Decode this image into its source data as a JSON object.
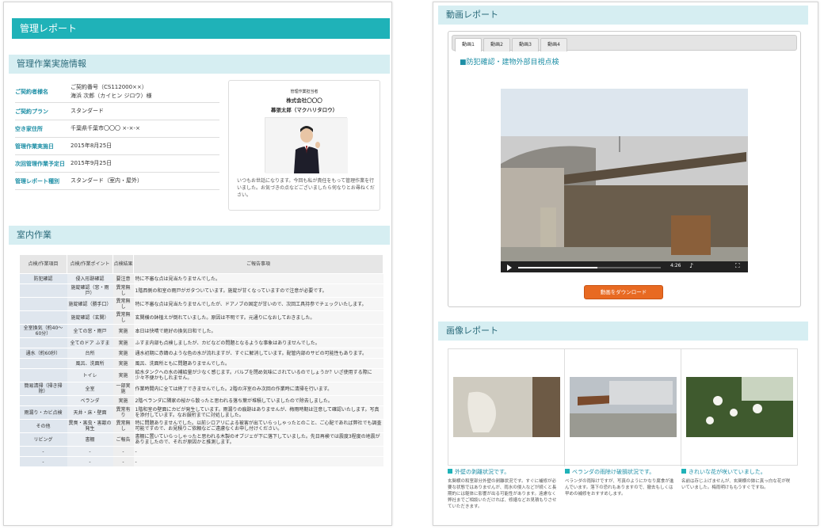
{
  "report": {
    "title": "管理レポート",
    "info_heading": "管理作業実施情報",
    "info_rows": [
      {
        "key": "ご契約者様名",
        "value": "ご契約番号（CS112000××）",
        "value2": "海浜 次郎（カイヒン ジロウ）様"
      },
      {
        "key": "ご契約プラン",
        "value": "スタンダード",
        "value2": ""
      },
      {
        "key": "空き家住所",
        "value": "千葉県千葉市〇〇〇 ×-×-×",
        "value2": ""
      },
      {
        "key": "管理作業実施日",
        "value": "2015年8月25日",
        "value2": ""
      },
      {
        "key": "次回管理作業予定日",
        "value": "2015年9月25日",
        "value2": ""
      },
      {
        "key": "管理レポート種別",
        "value": "スタンダード（室内・屋外）",
        "value2": ""
      }
    ],
    "staff": {
      "role": "管理作業担当者",
      "company": "株式会社〇〇〇",
      "name": "幕張太郎（マクハリタロウ）",
      "message": "いつもお世話になります。今回も私が責任をもって管理作業を行いました。お気づきの点などございましたら何なりとお尋ねください。"
    },
    "indoor_heading": "室内作業",
    "indoor_headers": [
      "点検/作業項目",
      "点検/作業ポイント",
      "点検結果",
      "ご報告事項"
    ],
    "indoor_rows": [
      {
        "cat": "防犯確認",
        "point": "侵入形跡確認",
        "res": "要注意",
        "note": "特に不審な点は見当たりませんでした。",
        "sep": true
      },
      {
        "cat": "",
        "point": "施錠確認（窓・雨戸）",
        "res": "異常無し",
        "note": "1階西側の和室の雨戸がガタついています。施錠が甘くなっていますので注意が必要です。",
        "sep": false
      },
      {
        "cat": "",
        "point": "施錠確認（勝手口）",
        "res": "異常無し",
        "note": "特に不審な点は見当たりませんでしたが、ドアノブの固定が甘いので、次回工具持参でチェックいたします。",
        "sep": false
      },
      {
        "cat": "",
        "point": "施錠確認（玄関）",
        "res": "異常無し",
        "note": "玄関横の鉢植えが倒れていました。原因は不明です。元通りになおしておきました。",
        "sep": false
      },
      {
        "cat": "全室換気（約40〜60分）",
        "point": "全ての窓・雨戸",
        "res": "実施",
        "note": "本日は快晴で絶好の換気日和でした。",
        "sep": true
      },
      {
        "cat": "",
        "point": "全てのドア ふすま",
        "res": "実施",
        "note": "ふすま内部も点検しましたが、カビなどの問題となるような事象はありませんでした。",
        "sep": false
      },
      {
        "cat": "通水（約60秒）",
        "point": "台所",
        "res": "実施",
        "note": "通水初期に赤錆のような色の水が流れますが、すぐに解消しています。配管内部のサビの可能性もあります。",
        "sep": true
      },
      {
        "cat": "",
        "point": "風呂、洗面所",
        "res": "実施",
        "note": "風呂、洗面所ともに問題ありませんでした。",
        "sep": false
      },
      {
        "cat": "",
        "point": "トイレ",
        "res": "実施",
        "note": "給水タンクへの水の補給量が少なく感じます。バルブを閉め気味にされているのでしょうか？いざ使用する際に少々不便かもしれません。",
        "sep": false
      },
      {
        "cat": "簡易清掃（掃き掃除）",
        "point": "全室",
        "res": "一部実施",
        "note": "作業時間内に全ては終了できませんでした。2階の洋室のみ次回の作業時に清掃を行います。",
        "sep": true
      },
      {
        "cat": "",
        "point": "ベランダ",
        "res": "実施",
        "note": "2階ベランダに隣家の桜から散ったと思われる落ち葉が堆積していましたので除去しました。",
        "sep": false
      },
      {
        "cat": "雨漏り・カビ点検",
        "point": "天井・床・壁面",
        "res": "異常有り",
        "note": "1階和室の壁面にカビが発生しています。雨漏りの痕跡はありませんが、梅雨時期は注意して確認いたします。写真を添付しています。なお鼓桁までに対処しました。",
        "sep": true
      },
      {
        "cat": "その他",
        "point": "異臭・害虫・害獣の発生",
        "res": "異常無し",
        "note": "特に問題ありませんでした。以前シロアリによる被害が出ていらっしゃったとのこと、ご心配であれば弊社でも調査可能ですので、お見積りご依頼などご遠慮なくお申し付けください。",
        "sep": true
      },
      {
        "cat": "リビング",
        "point": "書棚",
        "res": "ご報告",
        "note": "書棚に置いていらっしゃったと思われる木製のオブジェが下に落下していました。先日再検では震度3程度の地震がありましたので、それが原因かと推測します。",
        "sep": true
      },
      {
        "cat": "-",
        "point": "-",
        "res": "-",
        "note": "-",
        "sep": true
      },
      {
        "cat": "-",
        "point": "-",
        "res": "-",
        "note": "-",
        "sep": true
      }
    ]
  },
  "video": {
    "heading": "動画レポート",
    "tabs": [
      "動画1",
      "動画2",
      "動画3",
      "動画4"
    ],
    "active_tab": 0,
    "title": "■防犯確認・建物外部目視点検",
    "time": "4:26",
    "download_label": "動画をダウンロード"
  },
  "images": {
    "heading": "画像レポート",
    "captions": [
      {
        "title": "外壁の剥離状況です。",
        "body": "玄関横の和室部分外壁の剥離状況です。すぐに補修が必要な状態ではありませんが、雨水の侵入などが続くと長期的には躯体に影響が出る可能性があります。遠慮なく弊社までご相談いただければ、修繕などお見積もりさせていただきます。"
      },
      {
        "title": "ベランダの雨除け破損状況です。",
        "body": "ベランダの雨除けですが、写真のようにかなり腐食が進んでいます。落下の恐れもありますので、撤去もしくは早めの補修をおすすめします。"
      },
      {
        "title": "きれいな花が咲いていました。",
        "body": "名前は存じ上げませんが、玄関横の鉢に真っ白な花が咲いていました。梅雨明けももうすぐですね。"
      }
    ]
  },
  "colors": {
    "accent": "#1fb2b8",
    "section": "#d6eef2",
    "button": "#e86a22"
  }
}
